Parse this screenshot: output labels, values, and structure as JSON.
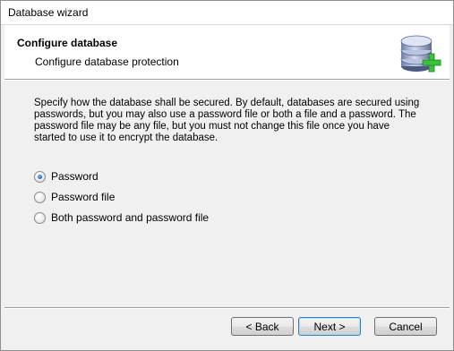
{
  "window": {
    "title": "Database wizard"
  },
  "header": {
    "title": "Configure database",
    "subtitle": "Configure database protection",
    "icon": "database-add-icon"
  },
  "description": "Specify how the database shall be secured. By default, databases are secured using passwords, but you may also use a password file or both a file and a password. The password file may be any file, but you must not change this file once you have started to use it to encrypt the database.",
  "options": [
    {
      "label": "Password",
      "checked": true
    },
    {
      "label": "Password file",
      "checked": false
    },
    {
      "label": "Both password and password file",
      "checked": false
    }
  ],
  "buttons": {
    "back": "< Back",
    "next": "Next >",
    "cancel": "Cancel"
  },
  "colors": {
    "window_bg": "#f0f0f0",
    "header_bg": "#ffffff",
    "default_button_border": "#3c7fb1",
    "icon_plus": "#3fbf3f"
  }
}
